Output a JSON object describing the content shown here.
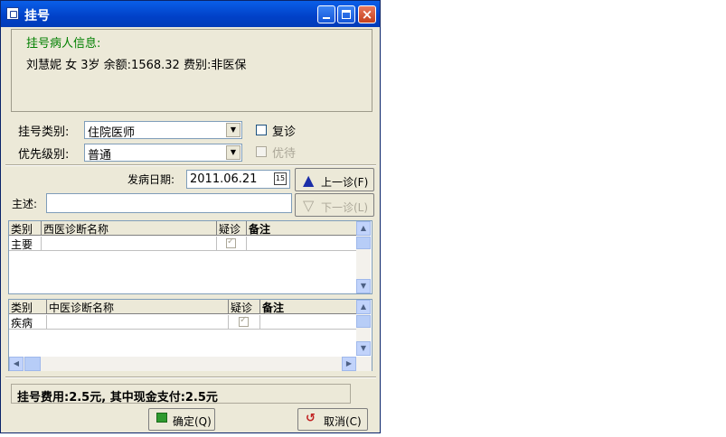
{
  "window": {
    "title": "挂号"
  },
  "patient": {
    "header": "挂号病人信息:",
    "details": "刘慧妮 女 3岁 余额:1568.32 费别:非医保"
  },
  "form": {
    "reg_type_label": "挂号类别:",
    "reg_type_value": "住院医师",
    "priority_label": "优先级别:",
    "priority_value": "普通",
    "revisit_label": "复诊",
    "priority_check_label": "优待"
  },
  "visit": {
    "onset_label": "发病日期:",
    "onset_date": "2011.06.21",
    "date_picker_glyph": "15",
    "prev_button": "上一诊(F)",
    "next_button": "下一诊(L)",
    "complaint_label": "主述:",
    "complaint_value": ""
  },
  "western_grid": {
    "headers": [
      "类别",
      "西医诊断名称",
      "疑诊",
      "备注"
    ],
    "rows": [
      {
        "category": "主要",
        "name": "",
        "suspected": true,
        "note": ""
      }
    ]
  },
  "chinese_grid": {
    "headers": [
      "类别",
      "中医诊断名称",
      "疑诊",
      "备注"
    ],
    "rows": [
      {
        "category": "疾病",
        "name": "",
        "suspected": true,
        "note": ""
      }
    ]
  },
  "footer": {
    "fee_text": "挂号费用:2.5元, 其中现金支付:2.5元",
    "ok_button": "确定(Q)",
    "cancel_button": "取消(C)"
  }
}
